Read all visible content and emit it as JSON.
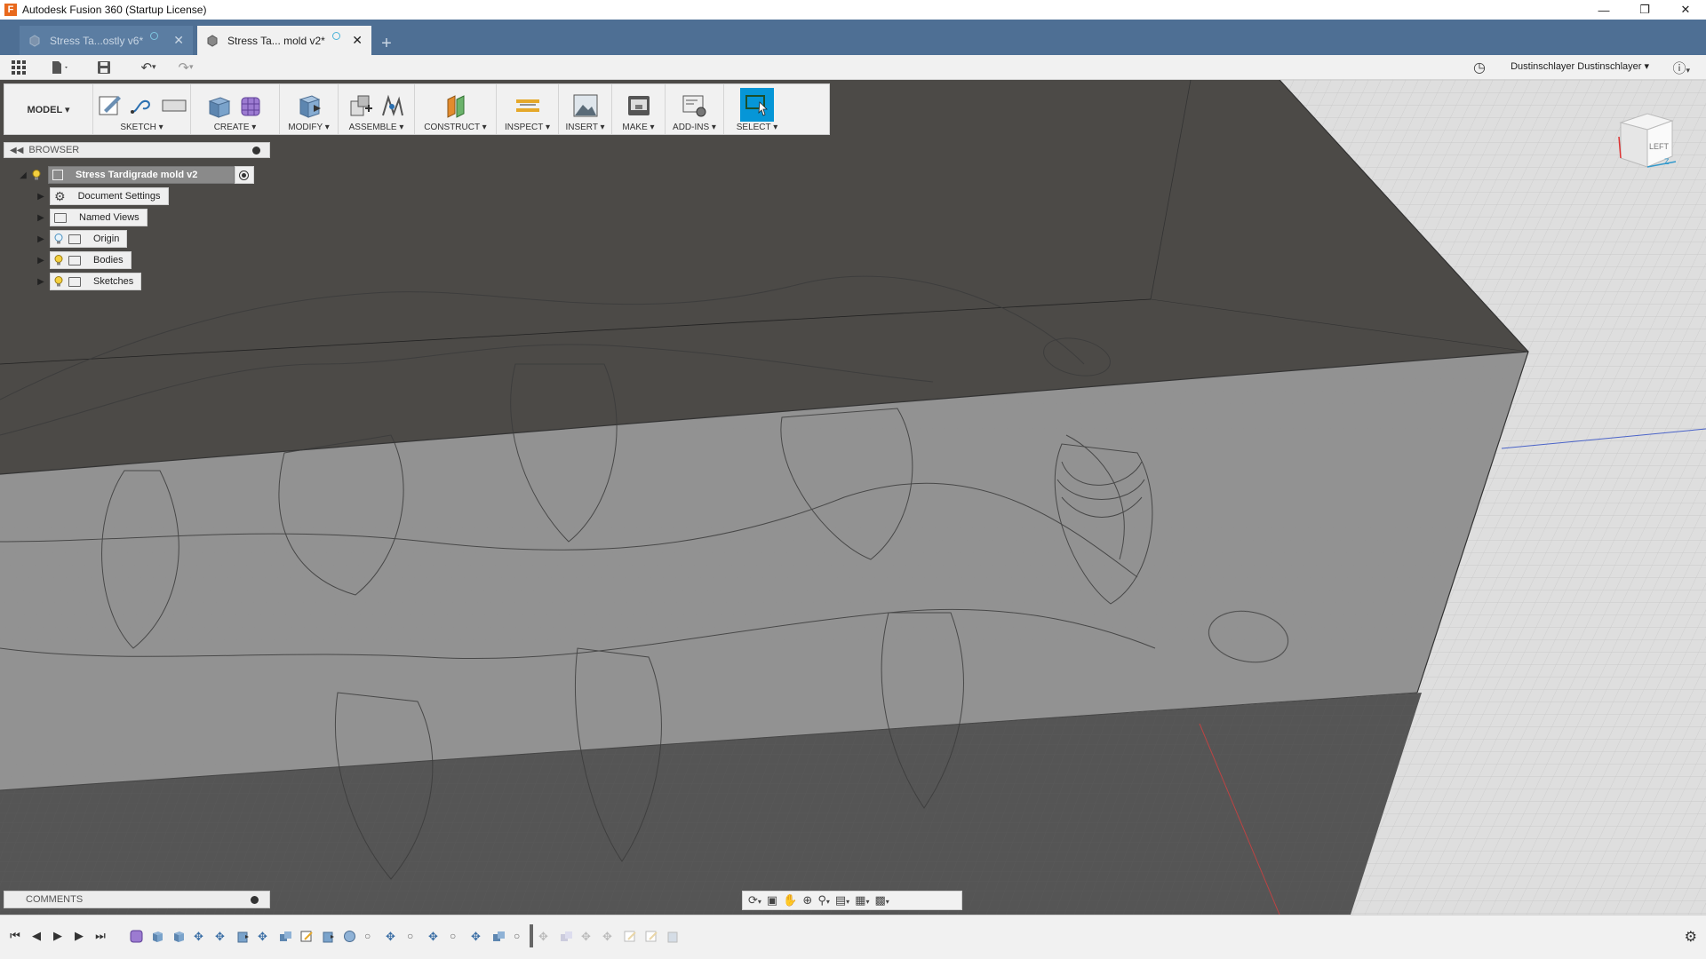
{
  "window": {
    "title": "Autodesk Fusion 360 (Startup License)",
    "minimize_icon": "minimize-icon",
    "maximize_icon": "restore-icon",
    "close_icon": "close-icon"
  },
  "tabs": [
    {
      "label": "Stress Ta...ostly v6*",
      "active": false
    },
    {
      "label": "Stress Ta... mold v2*",
      "active": true
    }
  ],
  "new_tab_symbol": "+",
  "quick_access": {
    "user": "Dustinschlayer Dustinschlayer ▾"
  },
  "ribbon": {
    "workspace": "MODEL ▾",
    "groups": [
      {
        "label": "SKETCH ▾"
      },
      {
        "label": "CREATE ▾"
      },
      {
        "label": "MODIFY ▾"
      },
      {
        "label": "ASSEMBLE ▾"
      },
      {
        "label": "CONSTRUCT ▾"
      },
      {
        "label": "INSPECT ▾"
      },
      {
        "label": "INSERT ▾"
      },
      {
        "label": "MAKE ▾"
      },
      {
        "label": "ADD-INS ▾"
      },
      {
        "label": "SELECT ▾"
      }
    ]
  },
  "browser": {
    "title": "BROWSER",
    "root": "Stress Tardigrade mold v2",
    "items": [
      {
        "label": "Document Settings",
        "icon": "gear-icon"
      },
      {
        "label": "Named Views",
        "icon": "folder-icon"
      },
      {
        "label": "Origin",
        "icon": "folder-icon"
      },
      {
        "label": "Bodies",
        "icon": "folder-icon"
      },
      {
        "label": "Sketches",
        "icon": "folder-icon"
      }
    ]
  },
  "comments": {
    "title": "COMMENTS"
  },
  "viewcube": {
    "face": "LEFT"
  },
  "colors": {
    "accent": "#0696d7",
    "tabbar": "#4e6f94",
    "toolbar": "#f1f1f1"
  }
}
